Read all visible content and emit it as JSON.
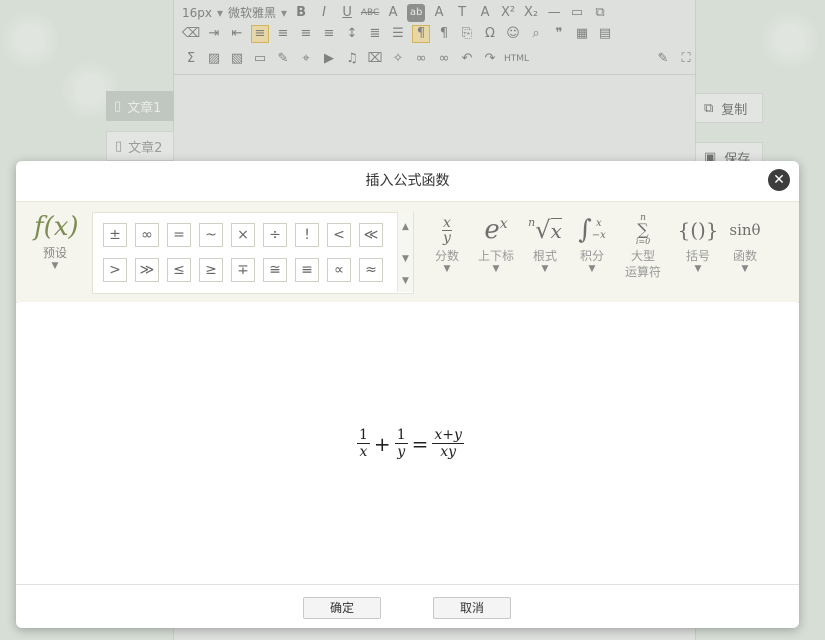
{
  "toolbar": {
    "font_size": "16px",
    "font_family": "微软雅黑",
    "html_label": "HTML"
  },
  "sidebar": {
    "items": [
      {
        "label": "文章1"
      },
      {
        "label": "文章2"
      }
    ]
  },
  "side_actions": {
    "copy_label": "复制",
    "save_label": "保存"
  },
  "dialog": {
    "title": "插入公式函数",
    "preset": {
      "label": "预设"
    },
    "symbols": [
      "±",
      "∞",
      "=",
      "~",
      "×",
      "÷",
      "!",
      "<",
      "≪",
      ">",
      "≫",
      "≤",
      "≥",
      "∓",
      "≅",
      "≡",
      "∝",
      "≈"
    ],
    "tools": [
      {
        "label": "分数"
      },
      {
        "label": "上下标"
      },
      {
        "label": "根式"
      },
      {
        "label": "积分"
      },
      {
        "label": "大型",
        "label2": "运算符"
      },
      {
        "label": "括号"
      },
      {
        "label": "函数",
        "icon_text": "sinθ"
      }
    ],
    "formula": {
      "t1_num": "1",
      "t1_den": "x",
      "plus": "+",
      "t2_num": "1",
      "t2_den": "y",
      "eq": "=",
      "rhs_num": "x+y",
      "rhs_den": "xy"
    },
    "confirm_label": "确定",
    "cancel_label": "取消"
  }
}
